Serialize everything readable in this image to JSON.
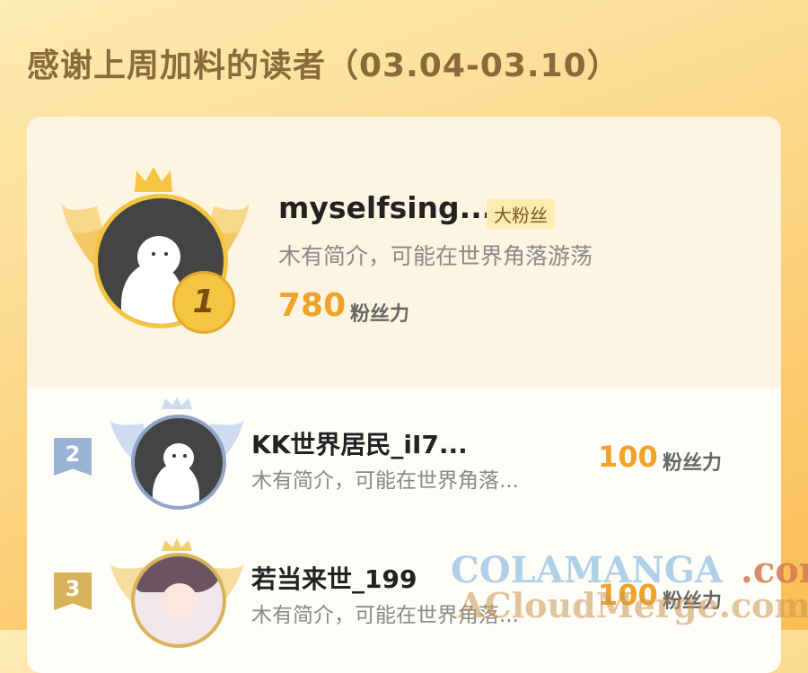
{
  "header": {
    "title": "感谢上周加料的读者（03.04-03.10）"
  },
  "leaderboard": {
    "top": {
      "rank": "1",
      "name": "myselfsing...",
      "badge": "大粉丝",
      "bio": "木有简介，可能在世界角落游荡",
      "score": "780",
      "unit": "粉丝力"
    },
    "rows": [
      {
        "rank": "2",
        "name": "KK世界居民_iI7...",
        "bio": "木有简介，可能在世界角落...",
        "score": "100",
        "unit": "粉丝力"
      },
      {
        "rank": "3",
        "name": "若当来世_199",
        "bio": "木有简介，可能在世界角落...",
        "score": "100",
        "unit": "粉丝力"
      }
    ]
  },
  "watermark": {
    "line1": "COLAMANGA",
    "line1_suffix": ".com",
    "line2": "ACloudMerge.com"
  },
  "colors": {
    "accent": "#f0a229",
    "gold": "#f5c542",
    "silver": "#9bb3d6",
    "bronze": "#d8b35a"
  },
  "icons": {
    "crown": "crown-icon",
    "wings": "wings-icon",
    "medal": "medal-icon"
  }
}
